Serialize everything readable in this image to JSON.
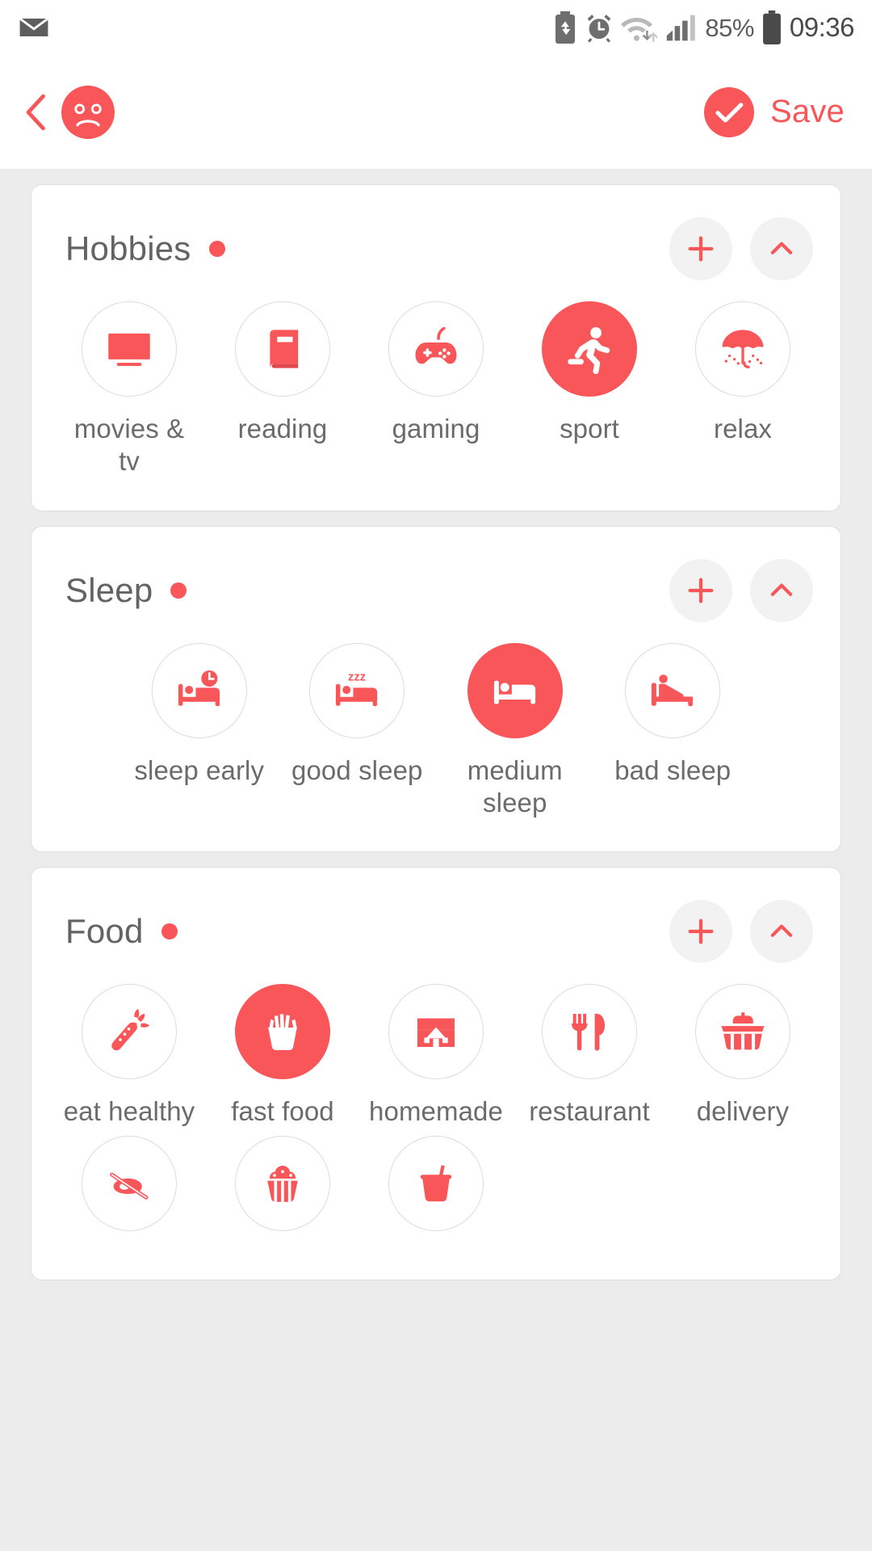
{
  "statusbar": {
    "icons_left": [
      "mail-icon"
    ],
    "icons_right": [
      "battery-saver-icon",
      "alarm-icon",
      "wifi-icon",
      "signal-icon"
    ],
    "battery_percent": "85%",
    "battery_icon": "battery-icon",
    "time": "09:36"
  },
  "header": {
    "back_icon": "back-chevron-icon",
    "avatar_icon": "sad-face-avatar",
    "save_check_icon": "check-circle-icon",
    "save_label": "Save"
  },
  "colors": {
    "accent": "#f9565a",
    "page_bg": "#ececec",
    "card_bg": "#ffffff",
    "text_gray": "#6b6b6b",
    "title_gray": "#636363",
    "circle_border": "#dcdcdc"
  },
  "sections": [
    {
      "title": "Hobbies",
      "dot": true,
      "add_label": "+",
      "collapse_icon": "chevron-up-icon",
      "columns": 5,
      "items": [
        {
          "label": "movies & tv",
          "icon": "tv-icon",
          "selected": false
        },
        {
          "label": "reading",
          "icon": "book-icon",
          "selected": false
        },
        {
          "label": "gaming",
          "icon": "gamepad-icon",
          "selected": false
        },
        {
          "label": "sport",
          "icon": "running-icon",
          "selected": true
        },
        {
          "label": "relax",
          "icon": "umbrella-icon",
          "selected": false
        }
      ]
    },
    {
      "title": "Sleep",
      "dot": true,
      "add_label": "+",
      "collapse_icon": "chevron-up-icon",
      "columns": 4,
      "items": [
        {
          "label": "sleep early",
          "icon": "bed-clock-icon",
          "selected": false
        },
        {
          "label": "good sleep",
          "icon": "bed-zzz-icon",
          "selected": false
        },
        {
          "label": "medium sleep",
          "icon": "bed-icon",
          "selected": true
        },
        {
          "label": "bad sleep",
          "icon": "bed-awake-icon",
          "selected": false
        }
      ]
    },
    {
      "title": "Food",
      "dot": true,
      "add_label": "+",
      "collapse_icon": "chevron-up-icon",
      "columns": 5,
      "items": [
        {
          "label": "eat healthy",
          "icon": "carrot-icon",
          "selected": false
        },
        {
          "label": "fast food",
          "icon": "fries-icon",
          "selected": true
        },
        {
          "label": "homemade",
          "icon": "home-icon",
          "selected": false
        },
        {
          "label": "restaurant",
          "icon": "fork-knife-icon",
          "selected": false
        },
        {
          "label": "delivery",
          "icon": "basket-icon",
          "selected": false
        },
        {
          "label": "",
          "icon": "no-meat-icon",
          "selected": false
        },
        {
          "label": "",
          "icon": "cupcake-icon",
          "selected": false
        },
        {
          "label": "",
          "icon": "soda-cup-icon",
          "selected": false
        }
      ]
    }
  ]
}
